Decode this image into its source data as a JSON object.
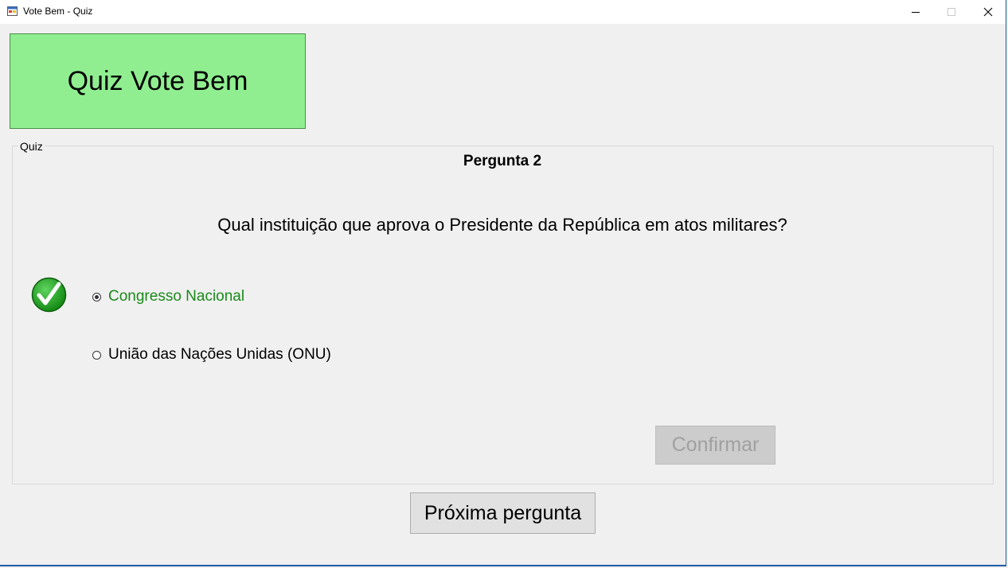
{
  "window": {
    "title": "Vote Bem - Quiz",
    "icons": {
      "app": "form-icon",
      "minimize": "minimize-icon",
      "maximize": "maximize-icon",
      "close": "close-icon"
    }
  },
  "header": {
    "title": "Quiz Vote Bem",
    "background_color": "#90ee90"
  },
  "quiz": {
    "group_label": "Quiz",
    "question_number": "Pergunta 2",
    "question_text": "Qual instituição que aprova o Presidente da República em atos militares?",
    "result_icon": "checkmark-icon",
    "options": [
      {
        "label": "Congresso Nacional",
        "selected": true,
        "color": "#1a8a1a"
      },
      {
        "label": "União das Nações Unidas (ONU)",
        "selected": false,
        "color": "#000000"
      }
    ],
    "confirm_label": "Confirmar",
    "confirm_enabled": false
  },
  "footer": {
    "next_label": "Próxima pergunta"
  }
}
